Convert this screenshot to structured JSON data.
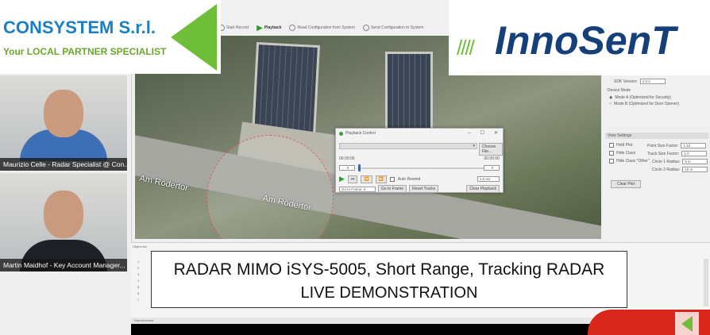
{
  "consystem": {
    "name": "CONSYSTEM S.r.l.",
    "tagline": "Your LOCAL PARTNER SPECIALIST"
  },
  "innosent": {
    "name": "InnoSenT",
    "bars": "////"
  },
  "participants": [
    {
      "name": "Maurizio Celle - Radar Specialist @ Con..."
    },
    {
      "name": "Martin Maidhof - Key Account Manager..."
    }
  ],
  "toolbar": {
    "items": [
      "Start Record",
      "Playback",
      "Read Configuration from System",
      "Send Configuration to System"
    ]
  },
  "map": {
    "labels": [
      "Am Rödertor",
      "Am Rödertor"
    ]
  },
  "right_panel": {
    "sdk_label": "SDK Version:",
    "sdk_value": "1.0.2",
    "device_mode": "Device Mode",
    "mode_a": "Mode A (Optimized for Security)",
    "mode_b": "Mode B (Optimized for Door Opener)",
    "view_settings": "View Settings",
    "hold_plot": "Hold Plot",
    "hide_class": "Hide Class",
    "hide_other": "Hide Class \"Other\"",
    "point_size_label": "Point Size Factor:",
    "point_size": "1.12",
    "track_size_label": "Track Size Factor:",
    "track_size": "1.0",
    "circle1_label": "Circle 1 Radius:",
    "circle1": "5 m",
    "circle2_label": "Circle 2 Radius:",
    "circle2": "10 m",
    "clear_plot": "Clear Plot"
  },
  "playback": {
    "title": "Playback Control",
    "choose_file": "Choose File...",
    "time_start": "00:00:00",
    "time_end": "00:00:00",
    "frame_start": "0",
    "frame_end": "0",
    "auto_rewind": "Auto Rewind",
    "speed": "1.0 ms",
    "goto_label": "Go to Frame: 0",
    "goto_btn": "Go to Frame",
    "reset_tracks": "Reset Tracks",
    "clear_playback": "Clear Playback"
  },
  "bottom": {
    "panel_title": "Object list",
    "rows": [
      "1",
      "2",
      "3",
      "4",
      "5",
      "6",
      "7"
    ]
  },
  "status": {
    "text": "Disconnected"
  },
  "overlay": {
    "line1": "RADAR MIMO  iSYS-5005, Short Range, Tracking RADAR",
    "line2": "LIVE DEMONSTRATION"
  }
}
